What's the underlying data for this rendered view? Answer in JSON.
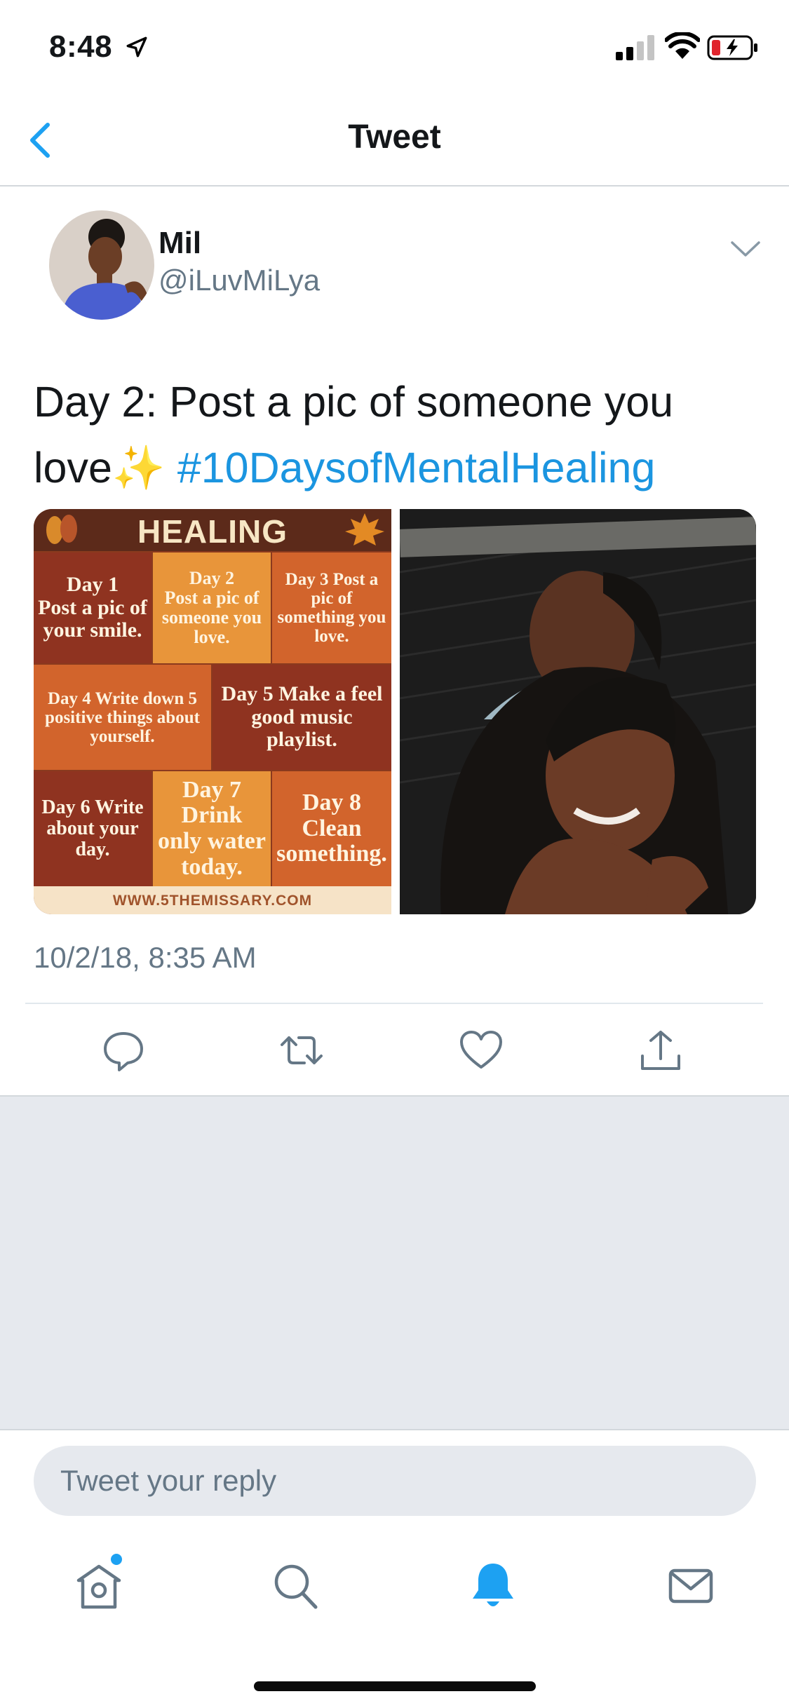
{
  "status_bar": {
    "time": "8:48"
  },
  "nav": {
    "title": "Tweet"
  },
  "author": {
    "name": "Mil",
    "handle": "@iLuvMiLya"
  },
  "tweet": {
    "text_part1": "Day 2: Post a pic of someone you love",
    "sparkle": "✨",
    "hashtag": "#10DaysofMentalHealing",
    "timestamp": "10/2/18, 8:35 AM"
  },
  "media_left": {
    "title": "HEALING",
    "cells": [
      "Day 1\nPost a pic of your smile.",
      "Day 2\nPost a pic of someone you love.",
      "Day 3 Post a pic of something you love.",
      "Day 4 Write down 5 positive things about yourself.",
      "Day 5 Make a feel good music playlist.",
      "Day 6 Write about your day.",
      "Day 7 Drink only water today.",
      "Day 8 Clean something."
    ],
    "footer": "WWW.5THEMISSARY.COM"
  },
  "reply": {
    "placeholder": "Tweet your reply"
  },
  "colors": {
    "accent": "#1da1f2",
    "hashtag": "#1b95e0",
    "secondary_text": "#657786"
  }
}
